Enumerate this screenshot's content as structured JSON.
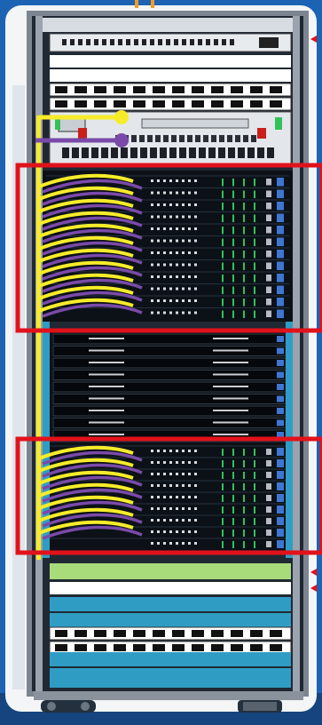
{
  "colors": {
    "background": "#1c63b4",
    "panel": "#f3f5f7",
    "rack_frame": "#6d7683",
    "rack_body": "#0f141a",
    "server_unit": "#0a0d12",
    "teal_band": "#2f9dc3",
    "light_green_band": "#a8dc7a",
    "cable_yellow": "#f6ec2a",
    "cable_purple": "#7a4aa9",
    "highlight_box": "#e1121b",
    "port_blue": "#3e76d2",
    "port_green": "#33c15a",
    "marker_orange": "#f59b1f"
  },
  "rack": {
    "upper_highlight_group": {
      "yellow_cables": 11,
      "purple_cables": 11
    },
    "lower_highlight_group": {
      "yellow_cables": 7,
      "purple_cables": 7
    }
  },
  "icons": {
    "highlight": "highlight-box-icon",
    "cable": "patch-cable-icon",
    "marker": "arrow-marker-icon",
    "wheel": "caster-wheel-icon"
  }
}
